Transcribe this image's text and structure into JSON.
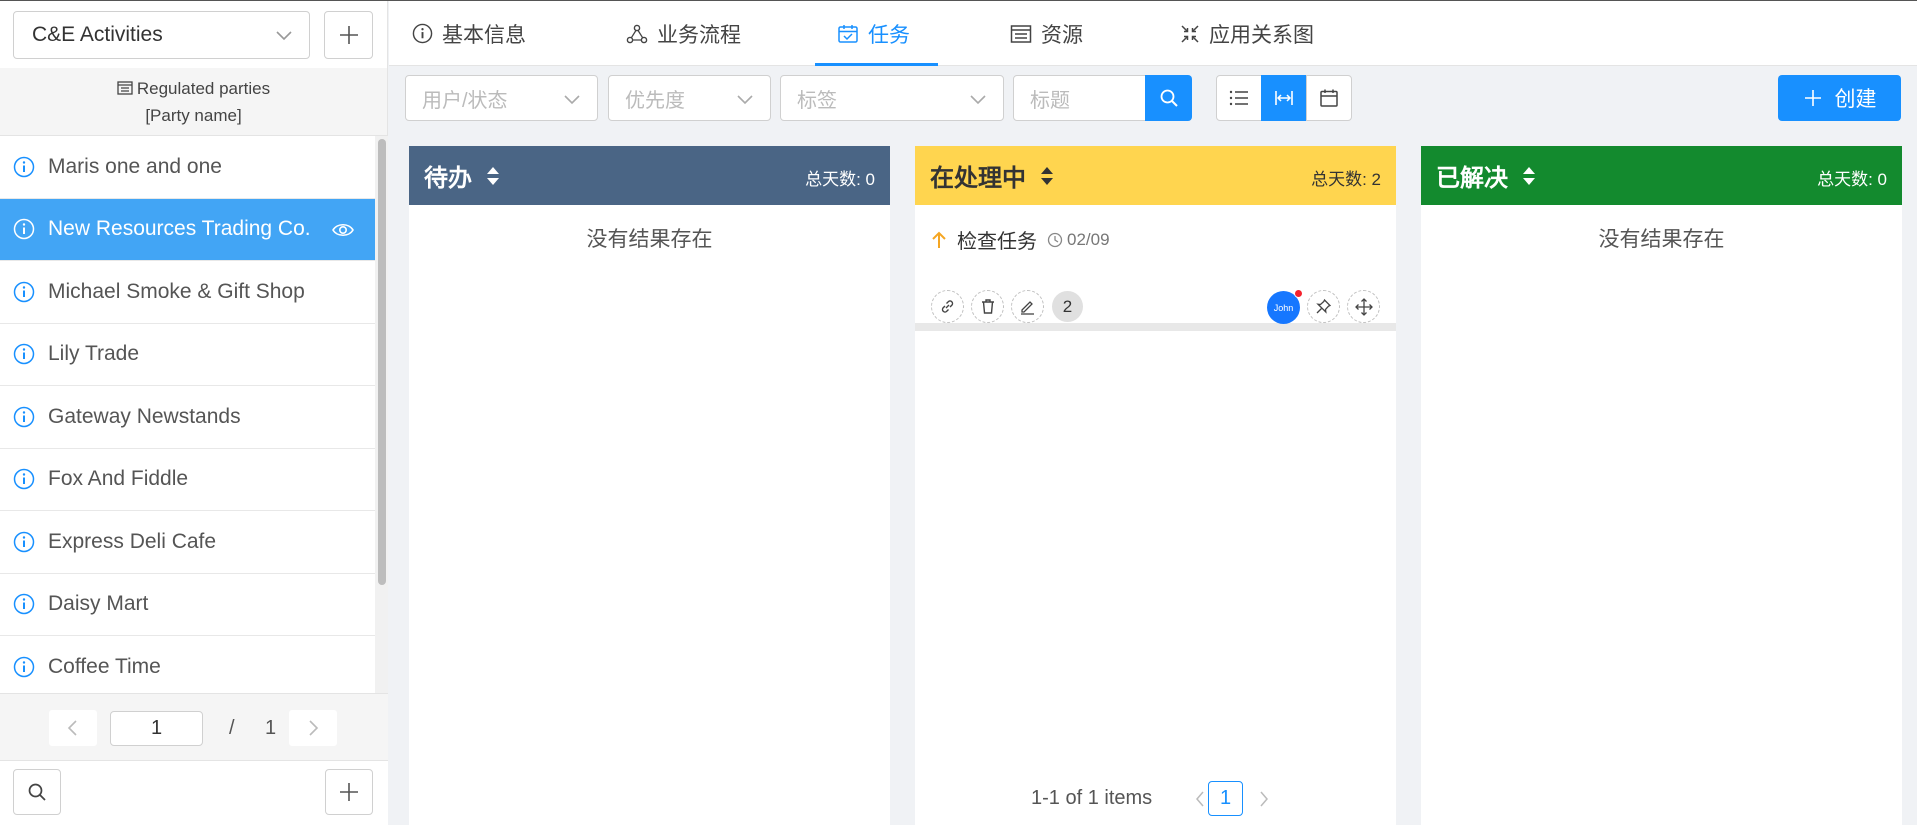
{
  "sidebar": {
    "selector_value": "C&E Activities",
    "party_header": "Regulated parties",
    "party_subheader": "[Party name]",
    "items": [
      {
        "label": "Maris one and one",
        "active": false
      },
      {
        "label": "New Resources Trading Co.",
        "active": true
      },
      {
        "label": "Michael Smoke & Gift Shop",
        "active": false
      },
      {
        "label": "Lily Trade",
        "active": false
      },
      {
        "label": "Gateway Newstands",
        "active": false
      },
      {
        "label": "Fox And Fiddle",
        "active": false
      },
      {
        "label": "Express Deli Cafe",
        "active": false
      },
      {
        "label": "Daisy Mart",
        "active": false
      },
      {
        "label": "Coffee Time",
        "active": false
      }
    ],
    "pager": {
      "current": "1",
      "separator": "/",
      "total": "1"
    }
  },
  "tabs": [
    {
      "label": "基本信息",
      "icon": "info-icon"
    },
    {
      "label": "业务流程",
      "icon": "workflow-icon"
    },
    {
      "label": "任务",
      "icon": "task-calendar-icon",
      "active": true
    },
    {
      "label": "资源",
      "icon": "resource-icon"
    },
    {
      "label": "应用关系图",
      "icon": "collapse-arrows-icon"
    }
  ],
  "toolbar": {
    "user_status_placeholder": "用户/状态",
    "priority_placeholder": "优先度",
    "tags_placeholder": "标签",
    "title_placeholder": "标题",
    "create_label": "创建"
  },
  "columns": [
    {
      "title": "待办",
      "total": "总天数: 0",
      "color": "#4a6585",
      "text_color": "#ffffff",
      "empty_text": "没有结果存在"
    },
    {
      "title": "在处理中",
      "total": "总天数: 2",
      "color": "#ffd54f",
      "text_color": "#333333",
      "cards": [
        {
          "title": "检查任务",
          "date": "02/09",
          "priority": "up-arrow",
          "edit_count": "2",
          "assignee": "John"
        }
      ],
      "pager": {
        "info": "1-1 of 1 items",
        "page": "1"
      }
    },
    {
      "title": "已解决",
      "total": "总天数: 0",
      "color": "#138a2e",
      "text_color": "#ffffff",
      "empty_text": "没有结果存在"
    }
  ],
  "colors": {
    "accent": "#1890ff",
    "sidebar_active": "#42a5f5",
    "priority_up": "#f5a623"
  }
}
